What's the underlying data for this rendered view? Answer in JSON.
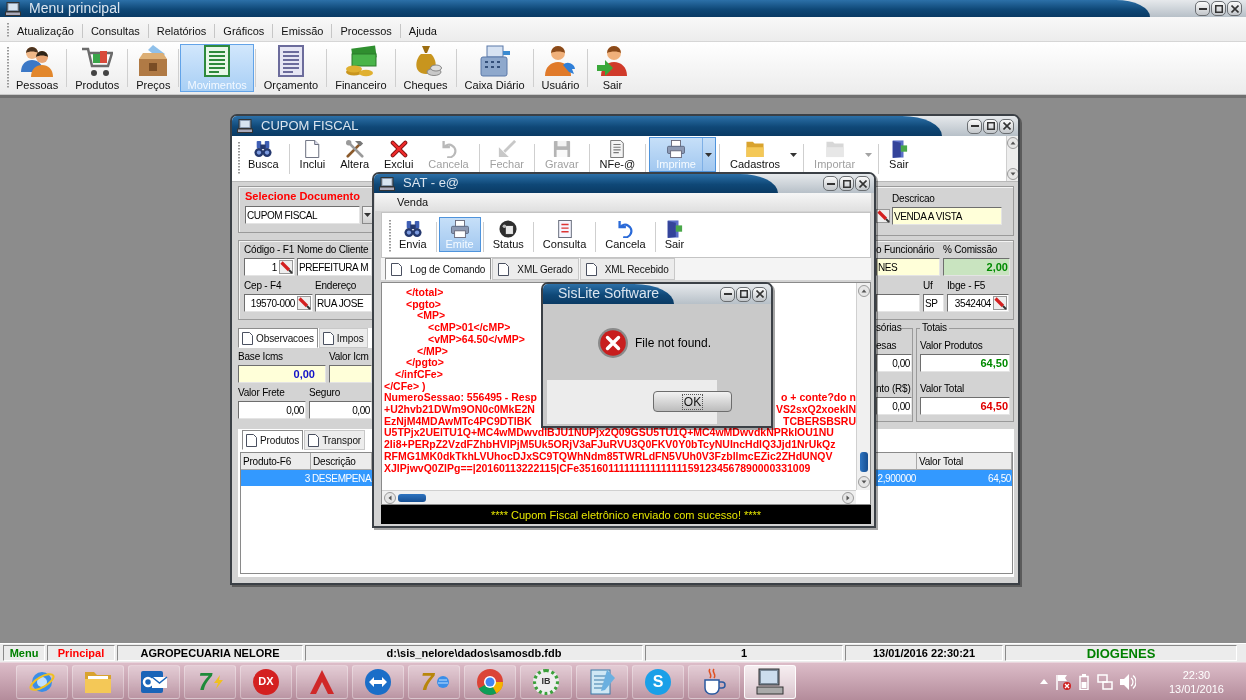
{
  "main_window": {
    "title": "Menu principal"
  },
  "menu": [
    "Atualização",
    "Consultas",
    "Relatórios",
    "Gráficos",
    "Emissão",
    "Processos",
    "Ajuda"
  ],
  "toolbar": [
    {
      "label": "Pessoas",
      "selected": false
    },
    {
      "label": "Produtos",
      "selected": false
    },
    {
      "label": "Preços",
      "selected": false
    },
    {
      "label": "Movimentos",
      "selected": true
    },
    {
      "label": "Orçamento",
      "selected": false
    },
    {
      "label": "Financeiro",
      "selected": false
    },
    {
      "label": "Cheques",
      "selected": false
    },
    {
      "label": "Caixa Diário",
      "selected": false
    },
    {
      "label": "Usuário",
      "selected": false
    },
    {
      "label": "Sair",
      "selected": false
    }
  ],
  "cupom_fiscal": {
    "title": "CUPOM FISCAL",
    "toolbar": [
      {
        "label": "Busca",
        "selected": false,
        "disabled": false,
        "dropdown": false
      },
      {
        "label": "Inclui",
        "selected": false,
        "disabled": false,
        "dropdown": false
      },
      {
        "label": "Altera",
        "selected": false,
        "disabled": false,
        "dropdown": false
      },
      {
        "label": "Exclui",
        "selected": false,
        "disabled": false,
        "dropdown": false
      },
      {
        "label": "Cancela",
        "selected": false,
        "disabled": true,
        "dropdown": false
      },
      {
        "label": "Fechar",
        "selected": false,
        "disabled": true,
        "dropdown": false
      },
      {
        "label": "Gravar",
        "selected": false,
        "disabled": true,
        "dropdown": false
      },
      {
        "label": "NFe-@",
        "selected": false,
        "disabled": false,
        "dropdown": false
      },
      {
        "label": "Imprime",
        "selected": true,
        "disabled": false,
        "dropdown": true
      },
      {
        "label": "Cadastros",
        "selected": false,
        "disabled": false,
        "dropdown": true
      },
      {
        "label": "Importar",
        "selected": false,
        "disabled": true,
        "dropdown": true
      },
      {
        "label": "Sair",
        "selected": false,
        "disabled": false,
        "dropdown": false
      }
    ],
    "document": {
      "label": "Selecione Documento",
      "value": "CUPOM FISCAL"
    },
    "client_rows": [
      [
        {
          "label": "Código - F1",
          "value": "1",
          "kind": "lookup"
        },
        {
          "label": "Nome do Cliente",
          "value": "PREFEITURA M",
          "kind": "text"
        }
      ],
      [
        {
          "label": "Cep - F4",
          "value": "19570-000",
          "kind": "lookup"
        },
        {
          "label": "Endereço",
          "value": "RUA JOSE",
          "kind": "text"
        }
      ]
    ],
    "detail_tabs": [
      {
        "label": "Observacoes",
        "selected": true
      },
      {
        "label": "Impos",
        "selected": false
      }
    ],
    "tax_rows": [
      [
        {
          "label": "Base Icms",
          "value": "0,00",
          "kind": "tax"
        },
        {
          "label": "Valor Icm",
          "kind": "note"
        }
      ],
      [
        {
          "label": "Valor Frete",
          "value": "0,00",
          "kind": "number"
        },
        {
          "label": "Seguro",
          "value": "0,00",
          "kind": "number"
        }
      ]
    ],
    "description": {
      "label": "Descricao",
      "value": "VENDA A VISTA",
      "kind": "note"
    },
    "staff_rows": [
      [
        {
          "label": "o Funcionário",
          "value": "NES",
          "kind": "note"
        },
        {
          "label": "% Comissão",
          "value": "2,00",
          "kind": "rate"
        }
      ],
      [
        {
          "kind": "text"
        },
        {
          "label": "Uf",
          "value": "SP",
          "kind": "text"
        },
        {
          "label": "Ibge - F5",
          "value": "3542404",
          "kind": "lookup"
        }
      ]
    ],
    "extras": {
      "legend": "sórias",
      "fields": [
        {
          "label": "esas",
          "value": "0,00",
          "kind": "number"
        },
        {
          "label": "nto (R$)",
          "value": "0,00",
          "kind": "number"
        }
      ]
    },
    "totals": {
      "legend": "Totais",
      "fields": [
        {
          "label": "Valor Produtos",
          "value": "64,50",
          "kind": "gain"
        },
        {
          "label": "Valor Total",
          "value": "64,50",
          "kind": "due"
        }
      ]
    },
    "grid_tabs": [
      {
        "label": "Produtos",
        "selected": true
      },
      {
        "label": "Transpor",
        "selected": false
      }
    ],
    "grid": {
      "header": {
        "produto": "Produto-F6",
        "descricao": "Descrição",
        "valor_total": "Valor Total"
      },
      "rows": [
        {
          "selected": true,
          "produto": "3",
          "descricao": "DESEMPENA",
          "column_3": "2,900000",
          "valor_total": "64,50"
        }
      ]
    }
  },
  "sat_window": {
    "title": "SAT - e@",
    "menu": [
      "Venda"
    ],
    "toolbar": [
      {
        "label": "Envia",
        "selected": false
      },
      {
        "label": "Emite",
        "selected": true
      },
      {
        "label": "Status",
        "selected": false
      },
      {
        "label": "Consulta",
        "selected": false
      },
      {
        "label": "Cancela",
        "selected": false
      },
      {
        "label": "Sair",
        "selected": false
      }
    ],
    "tabs": [
      {
        "label": "Log de Comando",
        "selected": true
      },
      {
        "label": "XML Gerado",
        "selected": false
      },
      {
        "label": "XML Recebido",
        "selected": false
      }
    ],
    "log": {
      "tree": [
        {
          "children": [
            {
              "children": [
                {
                  "end": "</total>"
                },
                {
                  "text": "<pgto>",
                  "children": [
                    {
                      "text": "<MP>",
                      "children": [
                        {
                          "text": "<cMP>01</cMP>"
                        },
                        {
                          "text": "<vMP>64.50</vMP>"
                        }
                      ],
                      "end": "</MP>"
                    }
                  ],
                  "end": "</pgto>"
                }
              ],
              "end": "</infCFe>"
            }
          ],
          "end": "</CFe> )"
        }
      ],
      "lines": [
        {
          "text": "NumeroSessao: 556495 - Resp",
          "text_right": "o + conte?do n"
        },
        {
          "text": "+U2hvb21DWm9ON0c0MkE2N",
          "text_right": "VS2sxQ2xoekIN"
        },
        {
          "text": "EzNjM4MDAwMTc4PC9DTlBK",
          "text_right": "TCBERSBSRU"
        },
        {
          "text": "U5TPjx2UElTU1Q+MC4wMDwvdlBJU1NUPjx2Q09GSU5TU1Q+MC4wMDwvdkNPRklOU1NU"
        },
        {
          "text": "2Ii8+PERpZ2VzdFZhbHVlPjM5Uk5ORjV3aFJuRVU3Q0FKV0Y0bTcyNUIncHdlQ3Jjd1NrUkQz"
        },
        {
          "text": "RFMG1MK0dkTkhLVUhocDJxSC9TQWhNdm85TWRLdFN5VUh0V3FzbllmcEZic2ZHdUNQV"
        },
        {
          "text": "XJlPjwvQ0ZlPg==|20160113222115|CFe35160111111111111111591234567890000331009"
        }
      ]
    },
    "status": "**** Cupom Fiscal eletrônico enviado com sucesso! ****"
  },
  "dialog": {
    "title": "SisLite Software",
    "message": "File not found.",
    "buttons": [
      "OK"
    ]
  },
  "status_bar": [
    {
      "text": "Menu",
      "color": "#008000"
    },
    {
      "text": "Principal",
      "color": "#ff0000"
    },
    {
      "text": "AGROPECUARIA NELORE",
      "color": "#000000"
    },
    {
      "text": "d:\\sis_nelore\\dados\\samosdb.fdb",
      "color": "#000000"
    },
    {
      "text": "1",
      "color": "#000000"
    },
    {
      "text": "13/01/2016 22:30:21",
      "color": "#000000"
    },
    {
      "text": "DIOGENES",
      "color": "#008000"
    }
  ],
  "taskbar": {
    "apps": [
      {
        "active": false
      },
      {
        "active": false
      },
      {
        "active": false
      },
      {
        "label": "7",
        "active": false
      },
      {
        "label": "DX",
        "active": false
      },
      {
        "active": false
      },
      {
        "active": false
      },
      {
        "label": "7",
        "active": false
      },
      {
        "active": false
      },
      {
        "label": "IB",
        "active": false
      },
      {
        "active": false
      },
      {
        "label": "S",
        "active": false
      },
      {
        "active": false
      },
      {
        "active": true
      }
    ],
    "clock": {
      "time": "22:30",
      "date": "13/01/2016"
    }
  }
}
